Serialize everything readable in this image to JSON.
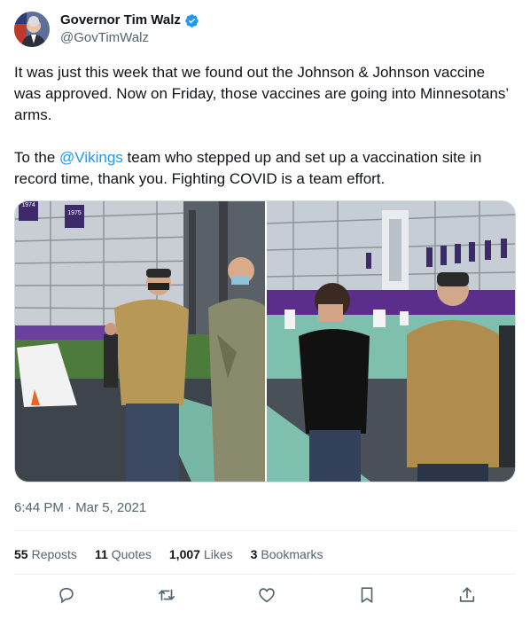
{
  "author": {
    "display_name": "Governor Tim Walz",
    "handle": "@GovTimWalz",
    "verified": true,
    "verified_color": "#1d9bf0",
    "avatar_icon": "avatar-photo"
  },
  "tweet": {
    "paragraph1": "It was just this week that we found out the Johnson & Johnson vaccine was approved. Now on Friday, those vaccines are going into Minnesotans’ arms.",
    "p2_before": "To the ",
    "p2_mention": "@Vikings",
    "p2_after": " team who stepped up and set up a vaccination site in record time, thank you. Fighting COVID is a team effort.",
    "mention_color": "#1d9bf0"
  },
  "media": {
    "photo1": {
      "banner1": "1974",
      "banner2": "1975"
    },
    "photo2": {}
  },
  "meta": {
    "timestamp": "6:44 PM · Mar 5, 2021"
  },
  "stats": {
    "reposts_count": "55",
    "reposts_label": "Reposts",
    "quotes_count": "11",
    "quotes_label": "Quotes",
    "likes_count": "1,007",
    "likes_label": "Likes",
    "bookmarks_count": "3",
    "bookmarks_label": "Bookmarks"
  },
  "actions": [
    "reply-icon",
    "retweet-icon",
    "like-icon",
    "bookmark-icon",
    "share-icon"
  ]
}
